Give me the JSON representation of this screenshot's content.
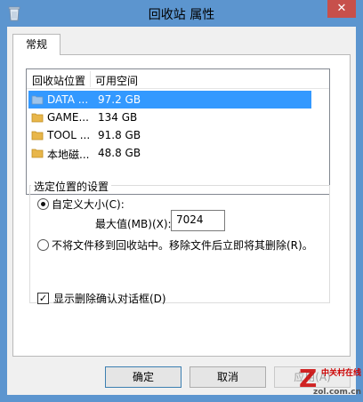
{
  "window": {
    "title": "回收站 属性",
    "close_glyph": "✕"
  },
  "tabs": [
    {
      "label": "常规",
      "active": true
    }
  ],
  "list": {
    "headers": [
      "回收站位置",
      "可用空间"
    ],
    "rows": [
      {
        "name": "DATA ...",
        "space": "97.2 GB",
        "selected": true
      },
      {
        "name": "GAME...",
        "space": "134 GB",
        "selected": false
      },
      {
        "name": "TOOL ...",
        "space": "91.8 GB",
        "selected": false
      },
      {
        "name": "本地磁...",
        "space": "48.8 GB",
        "selected": false
      }
    ]
  },
  "settings": {
    "group_title": "选定位置的设置",
    "custom_size_label": "自定义大小(C):",
    "max_label": "最大值(MB)(X):",
    "max_value": "7024",
    "delete_immediately_label": "不将文件移到回收站中。移除文件后立即将其删除(R)。",
    "custom_size_selected": true
  },
  "confirm": {
    "label": "显示删除确认对话框(D)",
    "checked": true,
    "check_glyph": "✓"
  },
  "buttons": {
    "ok": "确定",
    "cancel": "取消",
    "apply": "应用(A)"
  },
  "watermark": {
    "logo_letter": "Z",
    "top_text": "中关村在线",
    "bottom_text": "zol.com.cn"
  },
  "colors": {
    "selection": "#3399ff",
    "frame": "#5c95cf",
    "close": "#c7504b",
    "folder": "#e8b64a"
  }
}
